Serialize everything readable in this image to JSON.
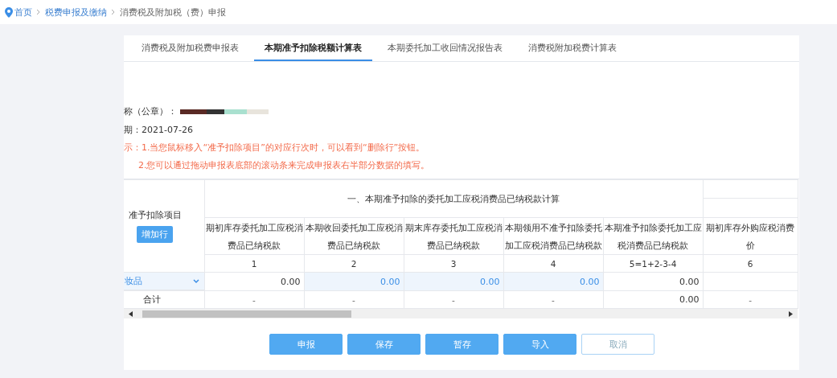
{
  "breadcrumb": [
    {
      "label": "首页",
      "kind": "link"
    },
    {
      "label": "税费申报及缴纳",
      "kind": "link"
    },
    {
      "label": "消费税及附加税（费）申报",
      "kind": "current"
    }
  ],
  "tabs": [
    {
      "label": "消费税及附加税费申报表",
      "selected": false
    },
    {
      "label": "本期准予扣除税额计算表",
      "selected": true
    },
    {
      "label": "本期委托加工收回情况报告表",
      "selected": false
    },
    {
      "label": "消费税附加税费计算表",
      "selected": false
    }
  ],
  "info": {
    "name_label": "称（公章）：",
    "date": "期：2021-07-26",
    "hints": [
      "示：1.当您鼠标移入“准予扣除项目”的对应行次时，可以看到“删除行”按钮。",
      "2.您可以通过拖动申报表底部的滚动条来完成申报表右半部分数据的填写。"
    ]
  },
  "table": {
    "item_header": "准予扣除项目",
    "add_row_button": "增加行",
    "group_header": "一、本期准予扣除的委托加工应税消费品已纳税款计算",
    "columns": [
      {
        "label": "期初库存委托加工应税消费品已纳税款",
        "index": "1"
      },
      {
        "label": "本期收回委托加工应税消费品已纳税款",
        "index": "2"
      },
      {
        "label": "期末库存委托加工应税消费品已纳税款",
        "index": "3"
      },
      {
        "label": "本期领用不准予扣除委托加工应税消费品已纳税款",
        "index": "4"
      },
      {
        "label": "本期准予扣除委托加工应税消费品已纳税款",
        "index": "5=1+2-3-4"
      },
      {
        "label": "期初库存外购应税消费价",
        "index": "6"
      }
    ],
    "rows": [
      {
        "kind": "item",
        "item": "妆品",
        "cells": [
          {
            "kind": "fixed",
            "value": "0.00"
          },
          {
            "kind": "entry",
            "value": "0.00"
          },
          {
            "kind": "entry",
            "value": "0.00"
          },
          {
            "kind": "entry",
            "value": "0.00"
          },
          {
            "kind": "fixed",
            "value": "0.00"
          },
          {
            "kind": "blank"
          }
        ]
      },
      {
        "kind": "total",
        "item": "合计",
        "cells": [
          {
            "kind": "dash",
            "value": "-"
          },
          {
            "kind": "dash",
            "value": "-"
          },
          {
            "kind": "dash",
            "value": "-"
          },
          {
            "kind": "dash",
            "value": "-"
          },
          {
            "kind": "fixed",
            "value": "0.00"
          },
          {
            "kind": "dash",
            "value": "-"
          }
        ]
      }
    ]
  },
  "buttons": [
    {
      "label": "申报",
      "kind": "primary"
    },
    {
      "label": "保存",
      "kind": "primary"
    },
    {
      "label": "暂存",
      "kind": "primary"
    },
    {
      "label": "导入",
      "kind": "primary"
    },
    {
      "label": "取消",
      "kind": "outline"
    }
  ]
}
